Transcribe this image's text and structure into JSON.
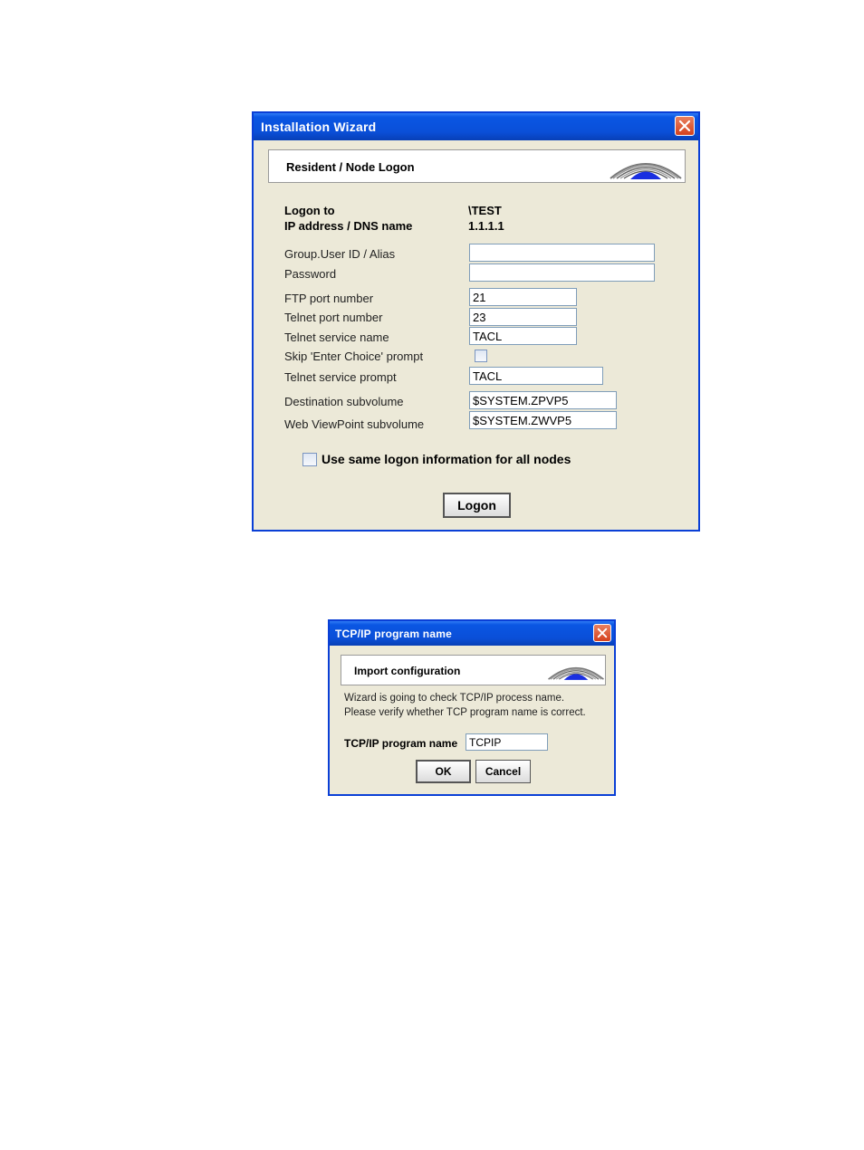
{
  "wizard": {
    "title": "Installation Wizard",
    "header": "Resident / Node Logon",
    "logon_to_label": "Logon to",
    "logon_to_value": "\\TEST",
    "ip_label": "IP address / DNS name",
    "ip_value": "1.1.1.1",
    "fields": {
      "user_label": "Group.User ID / Alias",
      "user_value": "",
      "password_label": "Password",
      "password_value": "",
      "ftp_label": "FTP port number",
      "ftp_value": "21",
      "telnet_port_label": "Telnet port number",
      "telnet_port_value": "23",
      "telnet_service_label": "Telnet service name",
      "telnet_service_value": "TACL",
      "skip_label": "Skip 'Enter Choice' prompt",
      "telnet_prompt_label": "Telnet service prompt",
      "telnet_prompt_value": "TACL",
      "dest_label": "Destination subvolume",
      "dest_value": "$SYSTEM.ZPVP5",
      "wvp_label": "Web ViewPoint subvolume",
      "wvp_value": "$SYSTEM.ZWVP5"
    },
    "same_logon_label": "Use same logon information for all nodes",
    "logon_button": "Logon"
  },
  "tcpip_dialog": {
    "title": "TCP/IP program name",
    "header": "Import configuration",
    "message_line1": "Wizard is going to check TCP/IP process name.",
    "message_line2": "Please verify whether TCP program name is correct.",
    "program_label": "TCP/IP program name",
    "program_value": "TCPIP",
    "ok_button": "OK",
    "cancel_button": "Cancel"
  },
  "colors": {
    "title_bar": "#0a4fd8",
    "close_button": "#d5411d",
    "dialog_bg": "#ece9d8",
    "logo_blue": "#1a2fe0"
  }
}
